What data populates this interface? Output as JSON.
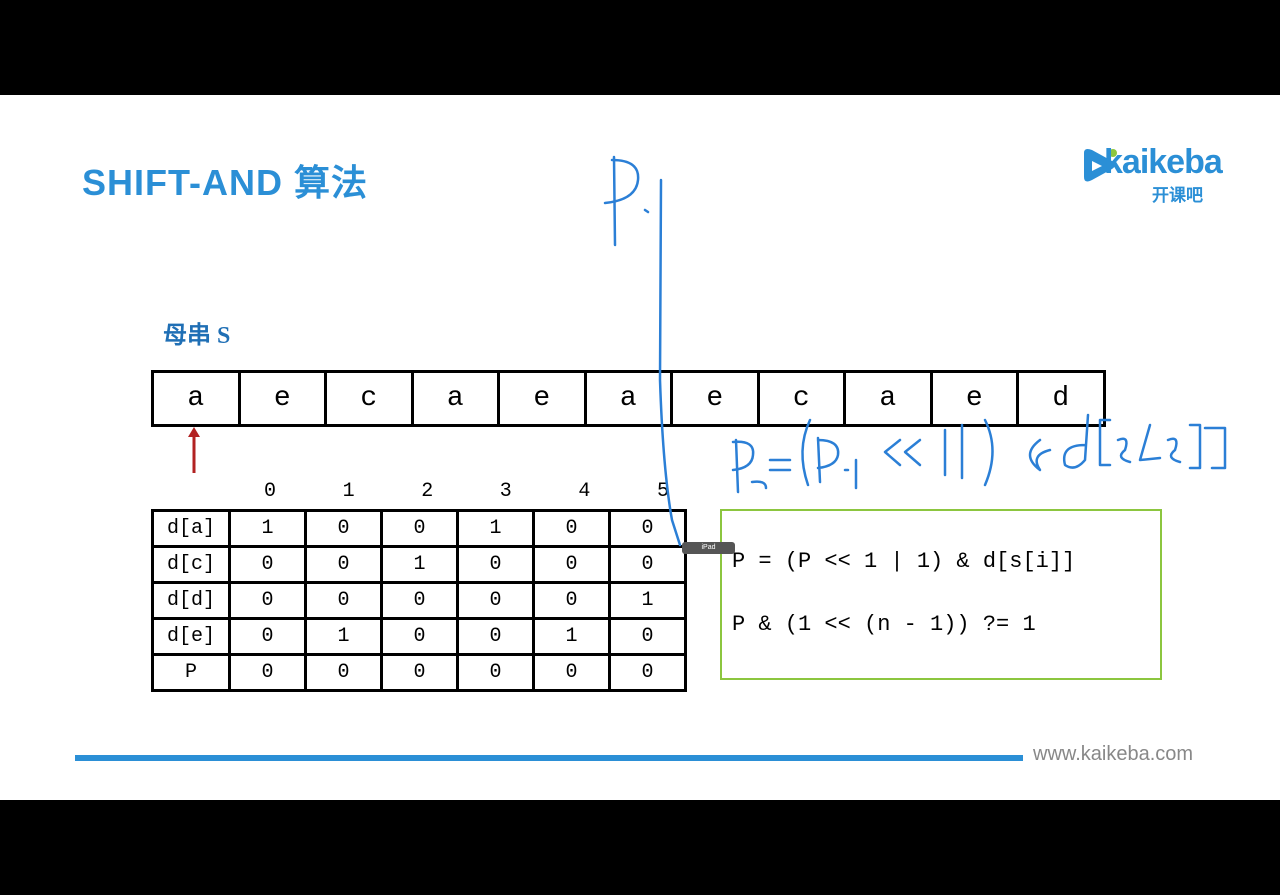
{
  "slide": {
    "title": "SHIFT-AND 算法",
    "logo": {
      "text": "kaikeba",
      "cn": "开课吧"
    },
    "mother_label": "母串 S",
    "string_chars": [
      "a",
      "e",
      "c",
      "a",
      "e",
      "a",
      "e",
      "c",
      "a",
      "e",
      "d"
    ],
    "table": {
      "columns": [
        "0",
        "1",
        "2",
        "3",
        "4",
        "5"
      ],
      "rows": [
        {
          "label": "d[a]",
          "values": [
            "1",
            "0",
            "0",
            "1",
            "0",
            "0"
          ]
        },
        {
          "label": "d[c]",
          "values": [
            "0",
            "0",
            "1",
            "0",
            "0",
            "0"
          ]
        },
        {
          "label": "d[d]",
          "values": [
            "0",
            "0",
            "0",
            "0",
            "0",
            "1"
          ]
        },
        {
          "label": "d[e]",
          "values": [
            "0",
            "1",
            "0",
            "0",
            "1",
            "0"
          ]
        },
        {
          "label": "P",
          "values": [
            "0",
            "0",
            "0",
            "0",
            "0",
            "0"
          ]
        }
      ]
    },
    "formulas": [
      "P = (P << 1 | 1) & d[s[i]]",
      "P & (1 << (n - 1)) ?= 1"
    ],
    "footer_url": "www.kaikeba.com",
    "ipad_tag": "iPad"
  },
  "colors": {
    "accent": "#2b8fd6",
    "arrow": "#b22222",
    "formula_border": "#8cc63f",
    "ink": "#2b7fd6"
  }
}
